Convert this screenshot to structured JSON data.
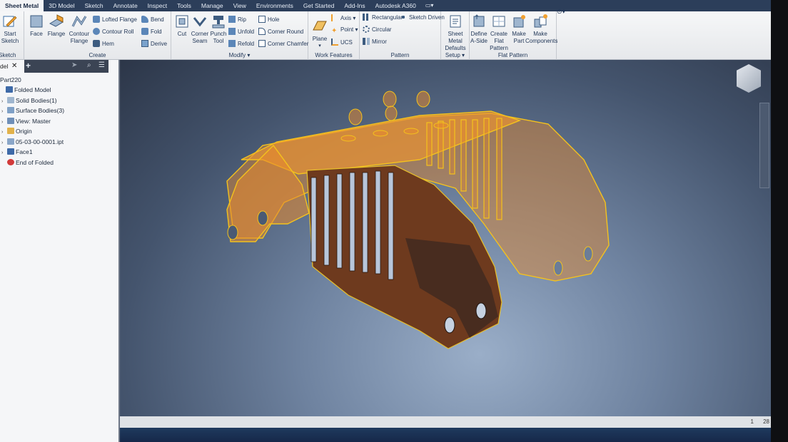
{
  "tabs": [
    {
      "label": "Sheet Metal",
      "active": true
    },
    {
      "label": "3D Model",
      "active": false
    },
    {
      "label": "Sketch",
      "active": false
    },
    {
      "label": "Annotate",
      "active": false
    },
    {
      "label": "Inspect",
      "active": false
    },
    {
      "label": "Tools",
      "active": false
    },
    {
      "label": "Manage",
      "active": false
    },
    {
      "label": "View",
      "active": false
    },
    {
      "label": "Environments",
      "active": false
    },
    {
      "label": "Get Started",
      "active": false
    },
    {
      "label": "Add-Ins",
      "active": false
    },
    {
      "label": "Autodesk A360",
      "active": false
    }
  ],
  "ribbon": {
    "sketch": {
      "start_line1": "Start",
      "start_line2": "Sketch",
      "title": "Sketch"
    },
    "create": {
      "title": "Create",
      "face": "Face",
      "flange": "Flange",
      "contour_line1": "Contour",
      "contour_line2": "Flange",
      "lofted_flange": "Lofted Flange",
      "contour_roll": "Contour Roll",
      "hem": "Hem",
      "bend": "Bend",
      "fold": "Fold",
      "derive": "Derive"
    },
    "modify": {
      "title": "Modify",
      "cut": "Cut",
      "corner_line1": "Corner",
      "corner_line2": "Seam",
      "punch_line1": "Punch",
      "punch_line2": "Tool",
      "rip": "Rip",
      "unfold": "Unfold",
      "refold": "Refold",
      "hole": "Hole",
      "corner_round": "Corner Round",
      "corner_chamfer": "Corner Chamfer"
    },
    "work_features": {
      "title": "Work Features",
      "plane": "Plane",
      "axis": "Axis",
      "point": "Point",
      "ucs": "UCS"
    },
    "pattern": {
      "title": "Pattern",
      "rectangular": "Rectangular",
      "circular": "Circular",
      "mirror": "Mirror",
      "sketch_driven": "Sketch Driven"
    },
    "setup": {
      "title": "Setup",
      "smd_line1": "Sheet Metal",
      "smd_line2": "Defaults"
    },
    "flat_pattern": {
      "title": "Flat Pattern",
      "define_line1": "Define",
      "define_line2": "A-Side",
      "create_line1": "Create",
      "create_line2": "Flat Pattern",
      "make_part_line1": "Make",
      "make_part_line2": "Part",
      "make_comp_line1": "Make",
      "make_comp_line2": "Components"
    }
  },
  "browser": {
    "tab_label": "del",
    "part_name": "Part220",
    "items": [
      {
        "label": "Folded Model",
        "icon": "folded-model-icon",
        "indent": 0,
        "arrow": false
      },
      {
        "label": "Solid Bodies(1)",
        "icon": "solid-body-icon",
        "indent": 1,
        "arrow": true
      },
      {
        "label": "Surface Bodies(3)",
        "icon": "surface-body-icon",
        "indent": 1,
        "arrow": true
      },
      {
        "label": "View: Master",
        "icon": "view-icon",
        "indent": 1,
        "arrow": true
      },
      {
        "label": "Origin",
        "icon": "folder-icon",
        "indent": 1,
        "arrow": true
      },
      {
        "label": "05-03-00-0001.ipt",
        "icon": "derived-part-icon",
        "indent": 1,
        "arrow": true
      },
      {
        "label": "Face1",
        "icon": "face-icon",
        "indent": 1,
        "arrow": true
      },
      {
        "label": "End of Folded",
        "icon": "end-of-part-icon",
        "indent": 1,
        "arrow": false
      }
    ]
  },
  "status": {
    "page_num": "1",
    "count": "28"
  },
  "colors": {
    "accent_orange": "#f0a030",
    "part_orange": "#e98a2c",
    "part_outline": "#f4c21d",
    "ribbon_tab_bg": "#2c3e5a"
  }
}
